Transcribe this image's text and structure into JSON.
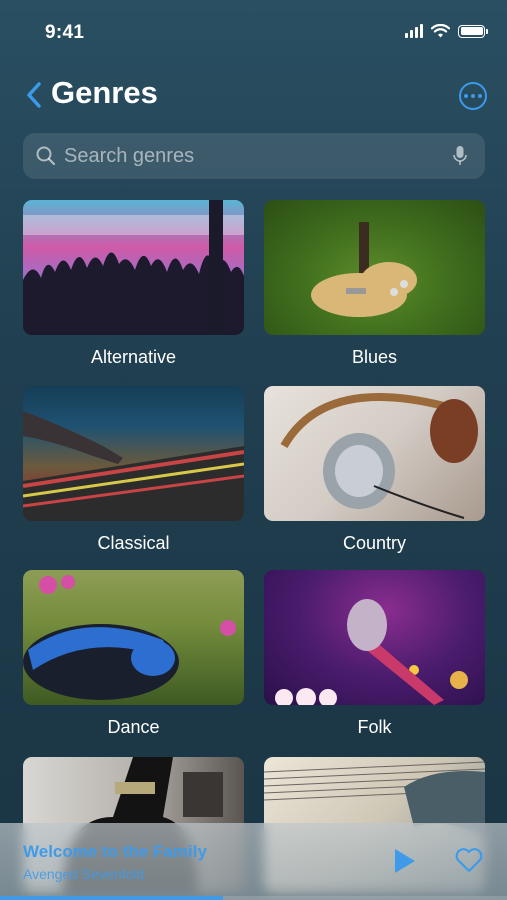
{
  "status_bar": {
    "time": "9:41"
  },
  "header": {
    "title": "Genres"
  },
  "search": {
    "placeholder": "Search genres"
  },
  "genres": [
    {
      "label": "Alternative"
    },
    {
      "label": "Blues"
    },
    {
      "label": "Classical"
    },
    {
      "label": "Country"
    },
    {
      "label": "Dance"
    },
    {
      "label": "Folk"
    },
    {
      "label": ""
    },
    {
      "label": ""
    }
  ],
  "now_playing": {
    "track": "Welcome to the Family",
    "artist": "Avenged Sevenfold",
    "progress_fraction": 0.44
  },
  "colors": {
    "accent": "#3b9bea",
    "background": "#203f50"
  },
  "icons": [
    "back-chevron-icon",
    "more-icon",
    "search-icon",
    "microphone-icon",
    "play-icon",
    "heart-icon"
  ]
}
